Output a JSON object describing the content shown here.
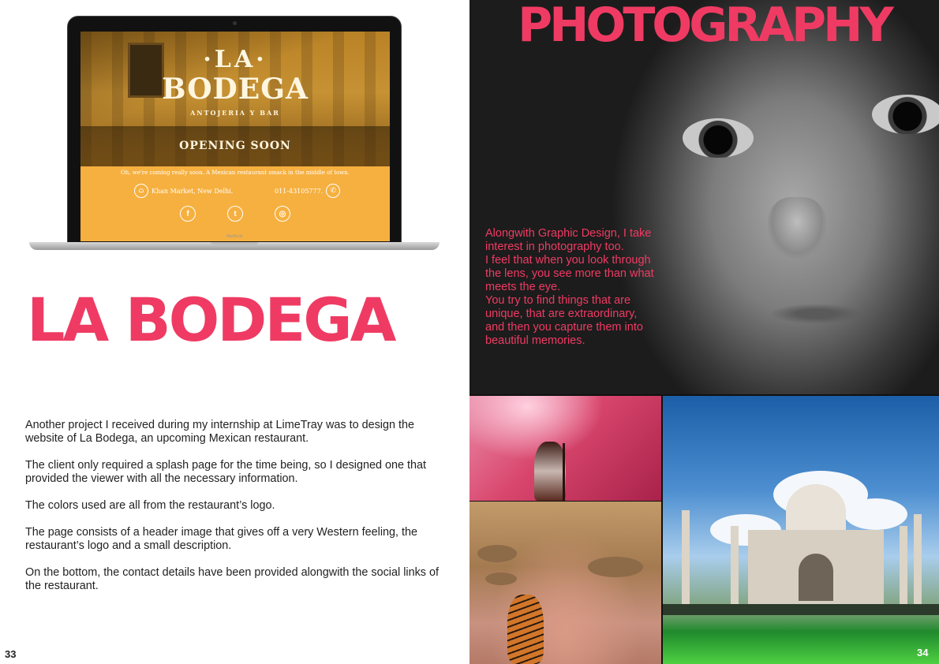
{
  "left_page": {
    "title": "LA BODEGA",
    "paragraphs": [
      "Another project I received during my internship at LimeTray was to design the website of La Bodega, an upcoming Mexican restaurant.",
      "The client only required a splash page for the time being, so I designed one that provided the viewer with all the necessary information.",
      "The colors used are all from the restaurant’s logo.",
      "The page consists of a header image that gives off a very Western feeling, the restaurant’s logo and a small description.",
      "On the bottom, the contact details have been provided alongwith the social links of the restaurant."
    ],
    "page_number": "33",
    "mockup": {
      "logo_line1": "·LA·",
      "logo_line2": "BODEGA",
      "logo_line3": "ANTOJERIA Y BAR",
      "status": "OPENING SOON",
      "tagline": "Oh, we're coming really soon. A Mexican restaurant smack in the middle of town.",
      "address": "Khan Market, New Delhi.",
      "phone": "011-43105777.",
      "device_label": "MacBook",
      "social_icons": [
        "facebook-icon",
        "twitter-icon",
        "instagram-icon"
      ],
      "accent_color": "#f6b040"
    }
  },
  "right_page": {
    "title": "PHOTOGRAPHY",
    "text": "Alongwith Graphic Design, I take interest in photography too.\nI feel that when you look through the lens, you see more than what meets the eye.\nYou try to find things that are unique, that are extraordinary, and then you capture them into beautiful memories.",
    "page_number": "34"
  },
  "colors": {
    "accent": "#ef3b63",
    "text": "#222222"
  }
}
